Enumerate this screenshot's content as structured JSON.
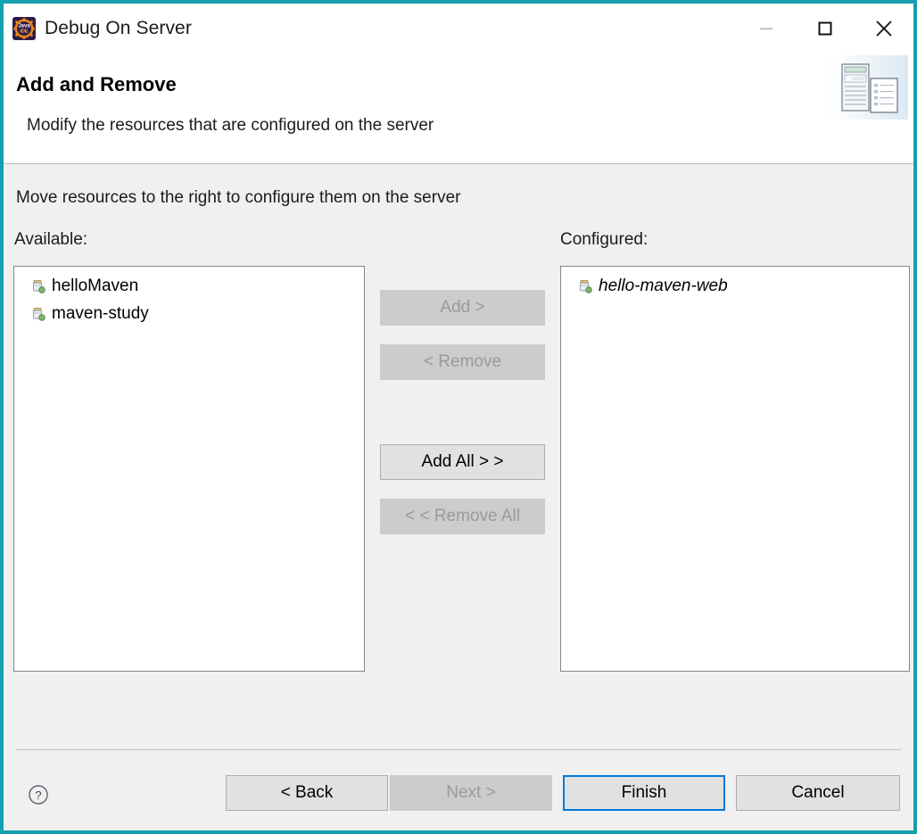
{
  "window": {
    "title": "Debug On Server",
    "app_icon": "eclipse-javaee-ide-icon",
    "controls": {
      "minimize_label": "—",
      "maximize_label": "□",
      "close_label": "✕"
    },
    "border_color": "#14a0ae"
  },
  "header": {
    "title": "Add and Remove",
    "subtitle": "Modify the resources that are configured on the server",
    "banner_icon": "server-and-document-banner"
  },
  "main": {
    "instruction": "Move resources to the right to configure them on the server",
    "available": {
      "label": "Available:",
      "items": [
        {
          "name": "helloMaven",
          "icon": "module-jar-icon",
          "italic": false
        },
        {
          "name": "maven-study",
          "icon": "module-jar-icon",
          "italic": false
        }
      ]
    },
    "configured": {
      "label": "Configured:",
      "items": [
        {
          "name": "hello-maven-web",
          "icon": "module-jar-icon",
          "italic": true
        }
      ]
    },
    "transfer_buttons": [
      {
        "label": "Add >",
        "enabled": false
      },
      {
        "label": "< Remove",
        "enabled": false
      },
      {
        "label": "Add All > >",
        "enabled": true
      },
      {
        "label": "< < Remove All",
        "enabled": false
      }
    ]
  },
  "footer": {
    "help_icon": "help-question-icon",
    "buttons": [
      {
        "label": "< Back",
        "enabled": true,
        "default": false
      },
      {
        "label": "Next >",
        "enabled": false,
        "default": false
      },
      {
        "label": "Finish",
        "enabled": true,
        "default": true
      },
      {
        "label": "Cancel",
        "enabled": true,
        "default": false
      }
    ]
  },
  "colors": {
    "accent_border": "#14a0ae",
    "content_bg": "#f0f0f0",
    "button_bg": "#e1e1e1",
    "button_disabled_bg": "#cccccc",
    "default_focus": "#0078d7"
  }
}
